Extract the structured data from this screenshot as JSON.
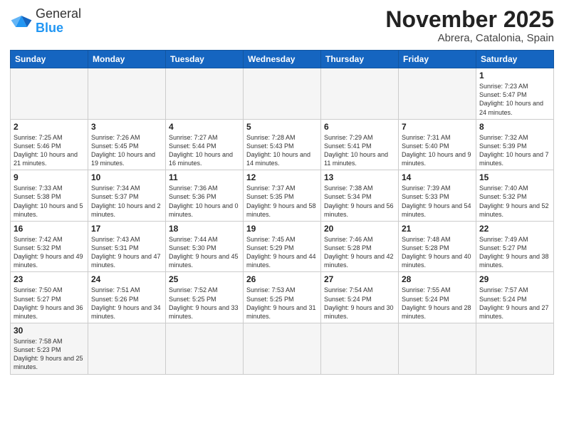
{
  "logo": {
    "general": "General",
    "blue": "Blue"
  },
  "header": {
    "month": "November 2025",
    "location": "Abrera, Catalonia, Spain"
  },
  "days_of_week": [
    "Sunday",
    "Monday",
    "Tuesday",
    "Wednesday",
    "Thursday",
    "Friday",
    "Saturday"
  ],
  "weeks": [
    [
      {
        "day": "",
        "info": "",
        "empty": true
      },
      {
        "day": "",
        "info": "",
        "empty": true
      },
      {
        "day": "",
        "info": "",
        "empty": true
      },
      {
        "day": "",
        "info": "",
        "empty": true
      },
      {
        "day": "",
        "info": "",
        "empty": true
      },
      {
        "day": "",
        "info": "",
        "empty": true
      },
      {
        "day": "1",
        "info": "Sunrise: 7:23 AM\nSunset: 5:47 PM\nDaylight: 10 hours and 24 minutes.",
        "empty": false
      }
    ],
    [
      {
        "day": "2",
        "info": "Sunrise: 7:25 AM\nSunset: 5:46 PM\nDaylight: 10 hours and 21 minutes.",
        "empty": false
      },
      {
        "day": "3",
        "info": "Sunrise: 7:26 AM\nSunset: 5:45 PM\nDaylight: 10 hours and 19 minutes.",
        "empty": false
      },
      {
        "day": "4",
        "info": "Sunrise: 7:27 AM\nSunset: 5:44 PM\nDaylight: 10 hours and 16 minutes.",
        "empty": false
      },
      {
        "day": "5",
        "info": "Sunrise: 7:28 AM\nSunset: 5:43 PM\nDaylight: 10 hours and 14 minutes.",
        "empty": false
      },
      {
        "day": "6",
        "info": "Sunrise: 7:29 AM\nSunset: 5:41 PM\nDaylight: 10 hours and 11 minutes.",
        "empty": false
      },
      {
        "day": "7",
        "info": "Sunrise: 7:31 AM\nSunset: 5:40 PM\nDaylight: 10 hours and 9 minutes.",
        "empty": false
      },
      {
        "day": "8",
        "info": "Sunrise: 7:32 AM\nSunset: 5:39 PM\nDaylight: 10 hours and 7 minutes.",
        "empty": false
      }
    ],
    [
      {
        "day": "9",
        "info": "Sunrise: 7:33 AM\nSunset: 5:38 PM\nDaylight: 10 hours and 5 minutes.",
        "empty": false
      },
      {
        "day": "10",
        "info": "Sunrise: 7:34 AM\nSunset: 5:37 PM\nDaylight: 10 hours and 2 minutes.",
        "empty": false
      },
      {
        "day": "11",
        "info": "Sunrise: 7:36 AM\nSunset: 5:36 PM\nDaylight: 10 hours and 0 minutes.",
        "empty": false
      },
      {
        "day": "12",
        "info": "Sunrise: 7:37 AM\nSunset: 5:35 PM\nDaylight: 9 hours and 58 minutes.",
        "empty": false
      },
      {
        "day": "13",
        "info": "Sunrise: 7:38 AM\nSunset: 5:34 PM\nDaylight: 9 hours and 56 minutes.",
        "empty": false
      },
      {
        "day": "14",
        "info": "Sunrise: 7:39 AM\nSunset: 5:33 PM\nDaylight: 9 hours and 54 minutes.",
        "empty": false
      },
      {
        "day": "15",
        "info": "Sunrise: 7:40 AM\nSunset: 5:32 PM\nDaylight: 9 hours and 52 minutes.",
        "empty": false
      }
    ],
    [
      {
        "day": "16",
        "info": "Sunrise: 7:42 AM\nSunset: 5:32 PM\nDaylight: 9 hours and 49 minutes.",
        "empty": false
      },
      {
        "day": "17",
        "info": "Sunrise: 7:43 AM\nSunset: 5:31 PM\nDaylight: 9 hours and 47 minutes.",
        "empty": false
      },
      {
        "day": "18",
        "info": "Sunrise: 7:44 AM\nSunset: 5:30 PM\nDaylight: 9 hours and 45 minutes.",
        "empty": false
      },
      {
        "day": "19",
        "info": "Sunrise: 7:45 AM\nSunset: 5:29 PM\nDaylight: 9 hours and 44 minutes.",
        "empty": false
      },
      {
        "day": "20",
        "info": "Sunrise: 7:46 AM\nSunset: 5:28 PM\nDaylight: 9 hours and 42 minutes.",
        "empty": false
      },
      {
        "day": "21",
        "info": "Sunrise: 7:48 AM\nSunset: 5:28 PM\nDaylight: 9 hours and 40 minutes.",
        "empty": false
      },
      {
        "day": "22",
        "info": "Sunrise: 7:49 AM\nSunset: 5:27 PM\nDaylight: 9 hours and 38 minutes.",
        "empty": false
      }
    ],
    [
      {
        "day": "23",
        "info": "Sunrise: 7:50 AM\nSunset: 5:27 PM\nDaylight: 9 hours and 36 minutes.",
        "empty": false
      },
      {
        "day": "24",
        "info": "Sunrise: 7:51 AM\nSunset: 5:26 PM\nDaylight: 9 hours and 34 minutes.",
        "empty": false
      },
      {
        "day": "25",
        "info": "Sunrise: 7:52 AM\nSunset: 5:25 PM\nDaylight: 9 hours and 33 minutes.",
        "empty": false
      },
      {
        "day": "26",
        "info": "Sunrise: 7:53 AM\nSunset: 5:25 PM\nDaylight: 9 hours and 31 minutes.",
        "empty": false
      },
      {
        "day": "27",
        "info": "Sunrise: 7:54 AM\nSunset: 5:24 PM\nDaylight: 9 hours and 30 minutes.",
        "empty": false
      },
      {
        "day": "28",
        "info": "Sunrise: 7:55 AM\nSunset: 5:24 PM\nDaylight: 9 hours and 28 minutes.",
        "empty": false
      },
      {
        "day": "29",
        "info": "Sunrise: 7:57 AM\nSunset: 5:24 PM\nDaylight: 9 hours and 27 minutes.",
        "empty": false
      }
    ],
    [
      {
        "day": "30",
        "info": "Sunrise: 7:58 AM\nSunset: 5:23 PM\nDaylight: 9 hours and 25 minutes.",
        "empty": false,
        "last": true
      },
      {
        "day": "",
        "info": "",
        "empty": true,
        "last": true
      },
      {
        "day": "",
        "info": "",
        "empty": true,
        "last": true
      },
      {
        "day": "",
        "info": "",
        "empty": true,
        "last": true
      },
      {
        "day": "",
        "info": "",
        "empty": true,
        "last": true
      },
      {
        "day": "",
        "info": "",
        "empty": true,
        "last": true
      },
      {
        "day": "",
        "info": "",
        "empty": true,
        "last": true
      }
    ]
  ]
}
